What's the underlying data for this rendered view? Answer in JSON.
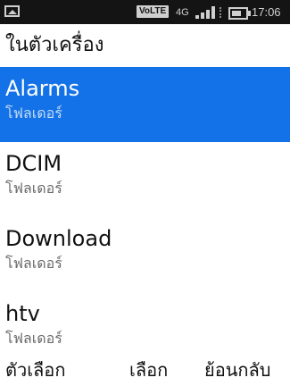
{
  "status_bar": {
    "volte_label": "VoLTE",
    "network": "4G",
    "time": "17:06",
    "icons": [
      "image-icon",
      "signal-icon",
      "battery-icon"
    ]
  },
  "header": {
    "title": "ในตัวเครื่อง"
  },
  "list": {
    "items": [
      {
        "name": "Alarms",
        "type": "โฟลเดอร์",
        "selected": true
      },
      {
        "name": "DCIM",
        "type": "โฟลเดอร์"
      },
      {
        "name": "Download",
        "type": "โฟลเดอร์"
      },
      {
        "name": "htv",
        "type": "โฟลเดอร์"
      }
    ]
  },
  "softkeys": {
    "left": "ตัวเลือก",
    "center": "เลือก",
    "right": "ย้อนกลับ"
  },
  "colors": {
    "selection": "#1472e8",
    "status_bar_bg": "#141414"
  }
}
